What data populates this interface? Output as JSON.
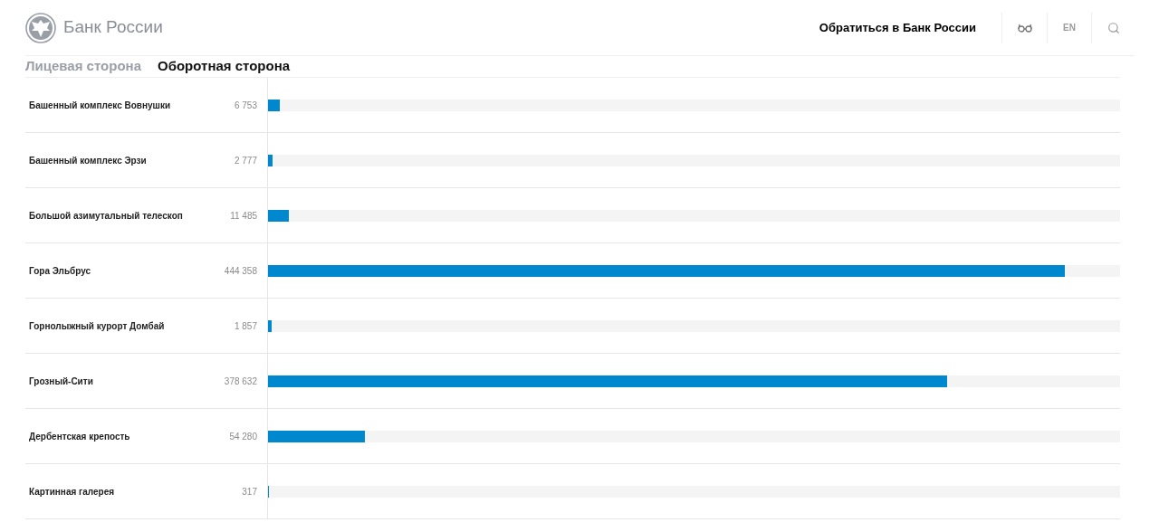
{
  "header": {
    "logo_text": "Банк России",
    "contact_link": "Обратиться в Банк России",
    "language": "EN"
  },
  "tabs": [
    {
      "label": "Лицевая сторона",
      "selected": false
    },
    {
      "label": "Оборотная сторона",
      "selected": true
    }
  ],
  "rows": [
    {
      "name": "Башенный комплекс Вовнушки",
      "value": "6 753",
      "level": 0.0142
    },
    {
      "name": "Башенный комплекс Эрзи",
      "value": "2 777",
      "level": 0.0058
    },
    {
      "name": "Большой азимутальный телескоп",
      "value": "11 485",
      "level": 0.024
    },
    {
      "name": "Гора Эльбрус",
      "value": "444 358",
      "level": 0.935
    },
    {
      "name": "Горнолыжный курорт Домбай",
      "value": "1 857",
      "level": 0.0039
    },
    {
      "name": "Грозный-Сити",
      "value": "378 632",
      "level": 0.797
    },
    {
      "name": "Дербентская крепость",
      "value": "54 280",
      "level": 0.114
    },
    {
      "name": "Картинная галерея",
      "value": "317",
      "level": 0.0007
    }
  ]
}
